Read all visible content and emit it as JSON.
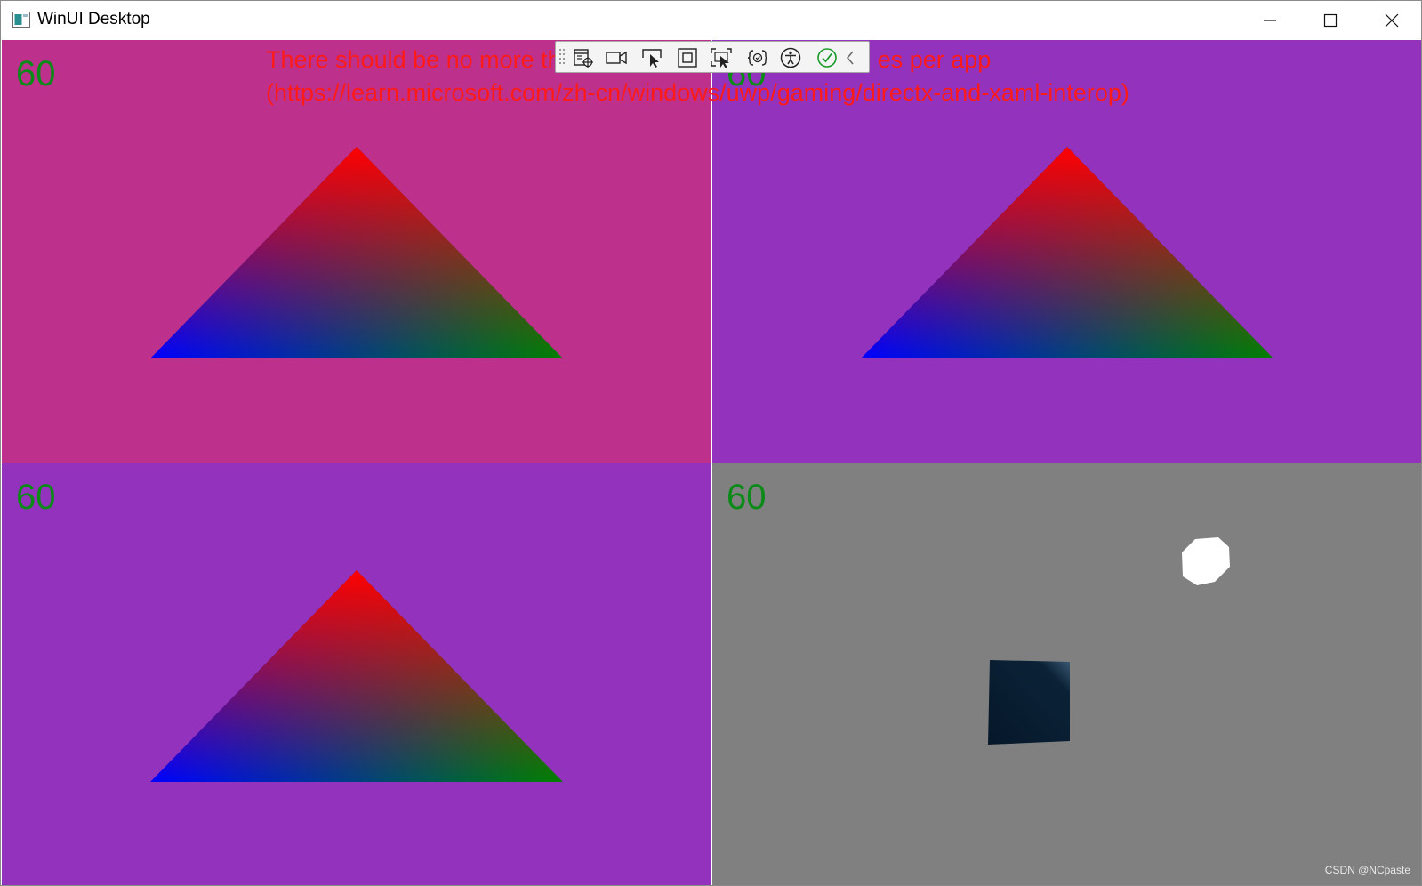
{
  "window": {
    "title": "WinUI Desktop",
    "icon": "app-window-icon",
    "controls": [
      "minimize-icon",
      "maximize-icon",
      "close-icon"
    ]
  },
  "overlay_message": {
    "line1": "There should be no more th",
    "line1_end": "es per app",
    "line2": "(https://learn.microsoft.com/zh-cn/windows/uwp/gaming/directx-and-xaml-interop)",
    "color": "#ff1a1a"
  },
  "panes": [
    {
      "fps": "60",
      "background": "#bd318c",
      "content": "rgb-gradient-triangle"
    },
    {
      "fps": "60",
      "background": "#9332bd",
      "content": "rgb-gradient-triangle"
    },
    {
      "fps": "60",
      "background": "#9332bd",
      "content": "rgb-gradient-triangle"
    },
    {
      "fps": "60",
      "background": "#808080",
      "content": "3d-scene"
    }
  ],
  "debug_toolbar": {
    "icons": [
      "live-visual-tree-icon",
      "record-icon",
      "select-element-icon",
      "display-layout-adorners-icon",
      "track-focused-element-icon",
      "hot-reload-icon",
      "accessibility-checker-icon",
      "ui-checked-icon",
      "collapse-toolbar-icon"
    ]
  },
  "watermark": "CSDN @NCpaste",
  "colors": {
    "fps_text": "#0a8a16",
    "triangle_top": "#ff0000",
    "triangle_left": "#0000ff",
    "triangle_right": "#008000"
  }
}
